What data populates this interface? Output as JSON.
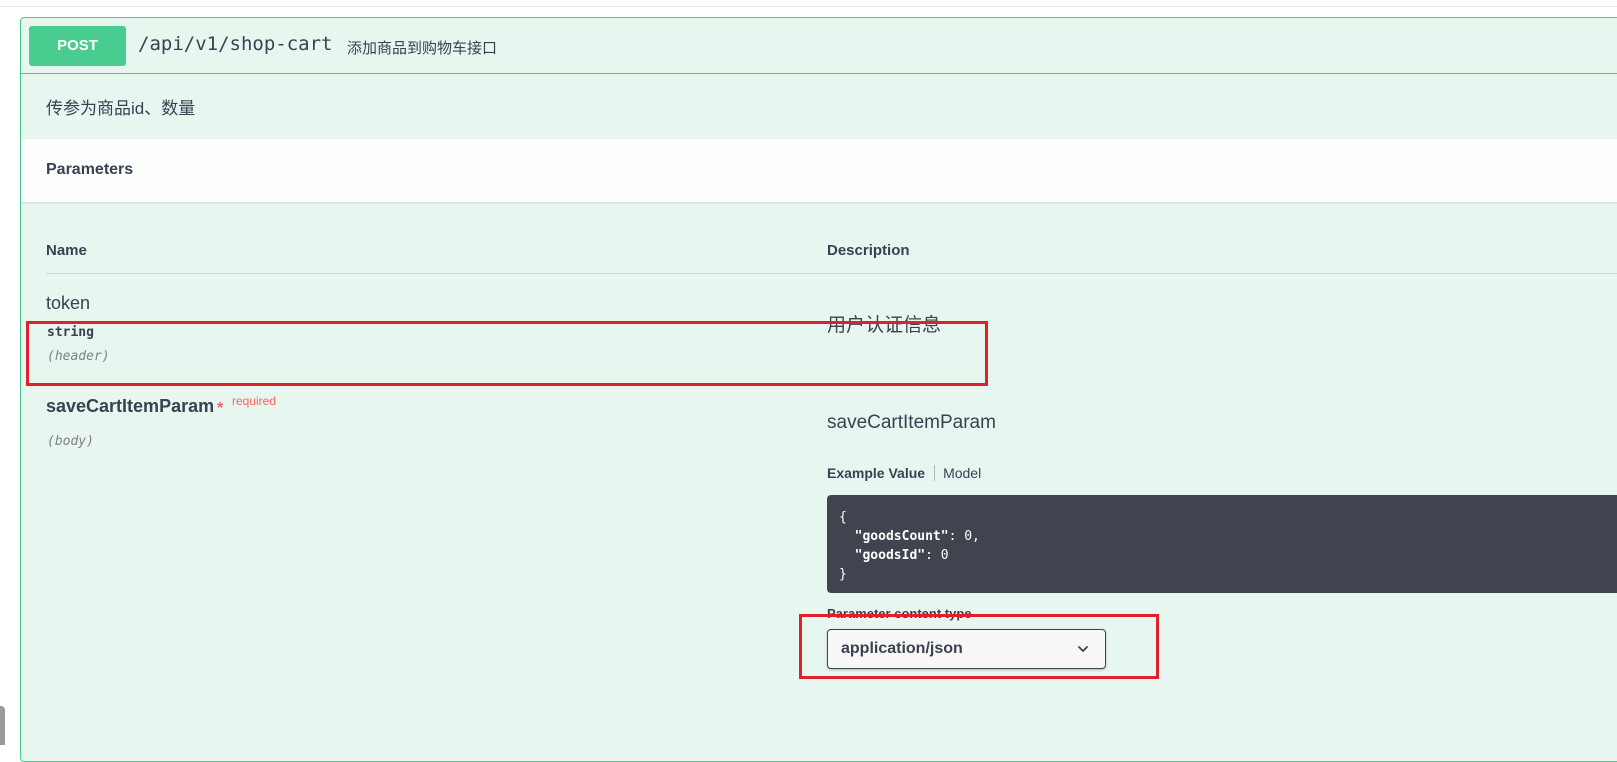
{
  "operation": {
    "method": "POST",
    "path": "/api/v1/shop-cart",
    "summary": "添加商品到购物车接口",
    "description": "传参为商品id、数量"
  },
  "parameters_section": {
    "title": "Parameters",
    "column_name": "Name",
    "column_description": "Description"
  },
  "params": [
    {
      "name": "token",
      "type": "string",
      "in": "(header)",
      "description": "用户认证信息"
    },
    {
      "name": "saveCartItemParam",
      "required_star": "*",
      "required_label": "required",
      "in": "(body)",
      "description": "saveCartItemParam"
    }
  ],
  "example": {
    "tab_example": "Example Value",
    "tab_model": "Model",
    "code_open": "{",
    "code_line1_key": "\"goodsCount\"",
    "code_line1_rest": ": 0,",
    "code_line2_key": "\"goodsId\"",
    "code_line2_rest": ": 0",
    "code_close": "}"
  },
  "content_type": {
    "label": "Parameter content type",
    "selected": "application/json"
  },
  "colors": {
    "post_green": "#49cc90",
    "block_bg": "#e8f6f0",
    "highlight_red": "#e0202a",
    "code_bg": "#41444e"
  },
  "icons": [
    "chevron-down-icon"
  ]
}
